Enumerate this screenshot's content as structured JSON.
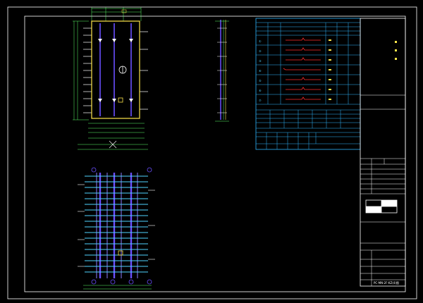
{
  "drawing": {
    "background": "#000000",
    "colors": {
      "frame": "#ffffff",
      "outline": "#ffe64a",
      "rebar_main": "#6a4fff",
      "rebar_cross": "#4fd3ff",
      "dimension": "#5cff6a",
      "table": "#2fb6ff",
      "mark": "#ff2b2b"
    }
  },
  "schedule_rows": [
    {
      "mark": "①"
    },
    {
      "mark": "②"
    },
    {
      "mark": "③"
    },
    {
      "mark": "④"
    },
    {
      "mark": "⑤"
    },
    {
      "mark": "⑥"
    },
    {
      "mark": "⑦"
    },
    {
      "mark": "⑧"
    }
  ],
  "title_block": {
    "drawing_no": "PC-MN-2F-KZ(4)图"
  }
}
